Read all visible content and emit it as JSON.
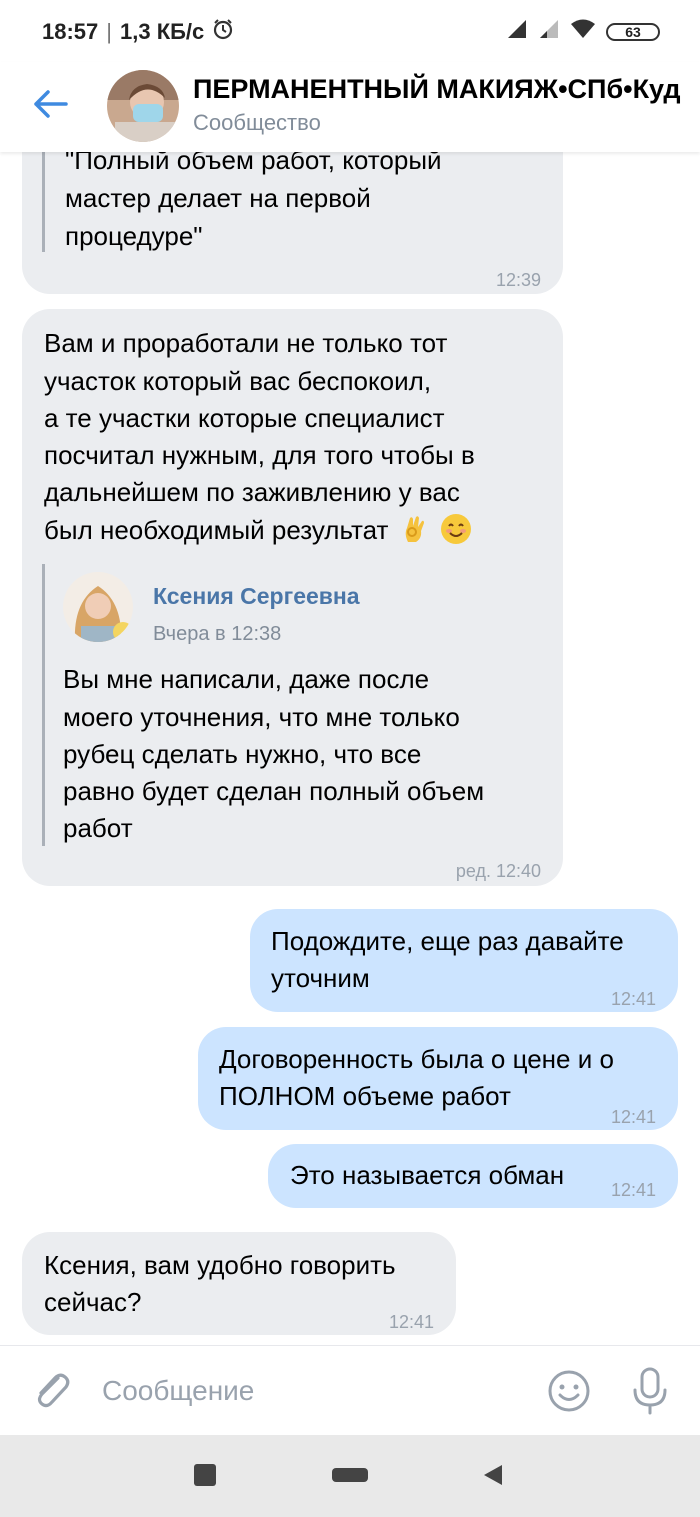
{
  "status_bar": {
    "time": "18:57",
    "network_speed": "1,3 КБ/с",
    "battery": "63"
  },
  "header": {
    "title": "ПЕРМАНЕНТНЫЙ МАКИЯЖ•СПб•Куд",
    "subtitle": "Сообщество"
  },
  "messages": [
    {
      "direction": "incoming",
      "lines": [
        "\"Полный объем работ, который",
        "мастер делает на первой",
        "процедуре\""
      ],
      "time": "12:39"
    },
    {
      "direction": "incoming",
      "lines": [
        "Вам и проработали не только тот",
        "участок который вас беспокоил,",
        "а те участки которые специалист",
        "посчитал нужным, для того чтобы в",
        "дальнейшем по заживлению у вас",
        "был необходимый результат"
      ],
      "emojis": [
        "ok-hand-emoji",
        "smiling-face-emoji"
      ],
      "quote": {
        "author": "Ксения Сергеевна",
        "date": "Вчера в 12:38",
        "lines": [
          "Вы мне написали, даже после",
          "моего уточнения, что мне только",
          "рубец сделать нужно, что все",
          "равно будет сделан полный объем",
          "работ"
        ]
      },
      "time": "ред. 12:40"
    },
    {
      "direction": "outgoing",
      "lines": [
        "Подождите, еще раз давайте",
        "уточним"
      ],
      "time": "12:41"
    },
    {
      "direction": "outgoing",
      "lines": [
        "Договоренность была о цене и о",
        "ПОЛНОМ объеме работ"
      ],
      "time": "12:41"
    },
    {
      "direction": "outgoing",
      "lines": [
        "Это называется обман"
      ],
      "time": "12:41"
    },
    {
      "direction": "incoming",
      "lines": [
        "Ксения, вам удобно говорить",
        "сейчас?"
      ],
      "time": "12:41"
    }
  ],
  "composer": {
    "placeholder": "Сообщение"
  },
  "colors": {
    "accent": "#4a76a8",
    "back_arrow": "#3f8ae0",
    "incoming_bubble": "#ebedf0",
    "outgoing_bubble": "#cce4ff",
    "meta_text": "#99a2ad"
  }
}
